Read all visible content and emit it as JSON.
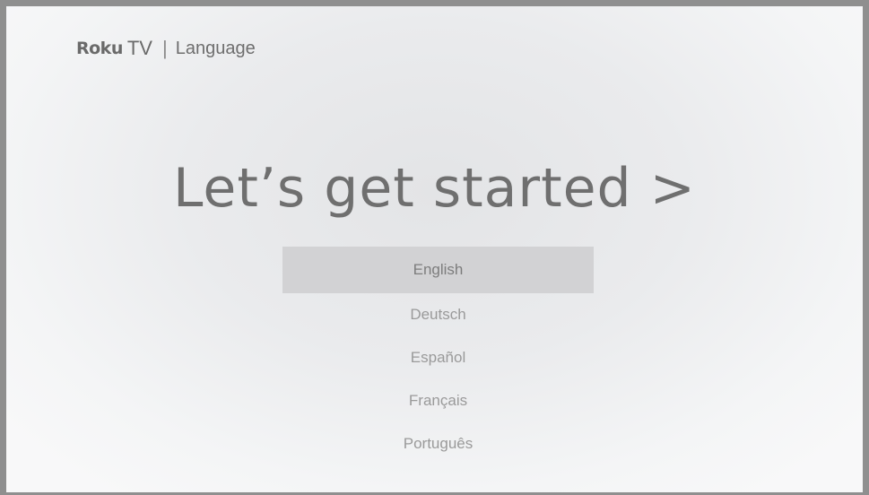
{
  "header": {
    "brand_roku": "Roku",
    "brand_tv": "TV",
    "separator": "|",
    "section": "Language"
  },
  "main": {
    "headline": "Let’s get started >"
  },
  "languages": {
    "selected_index": 0,
    "items": [
      {
        "label": "English"
      },
      {
        "label": "Deutsch"
      },
      {
        "label": "Español"
      },
      {
        "label": "Français"
      },
      {
        "label": "Português"
      }
    ]
  }
}
